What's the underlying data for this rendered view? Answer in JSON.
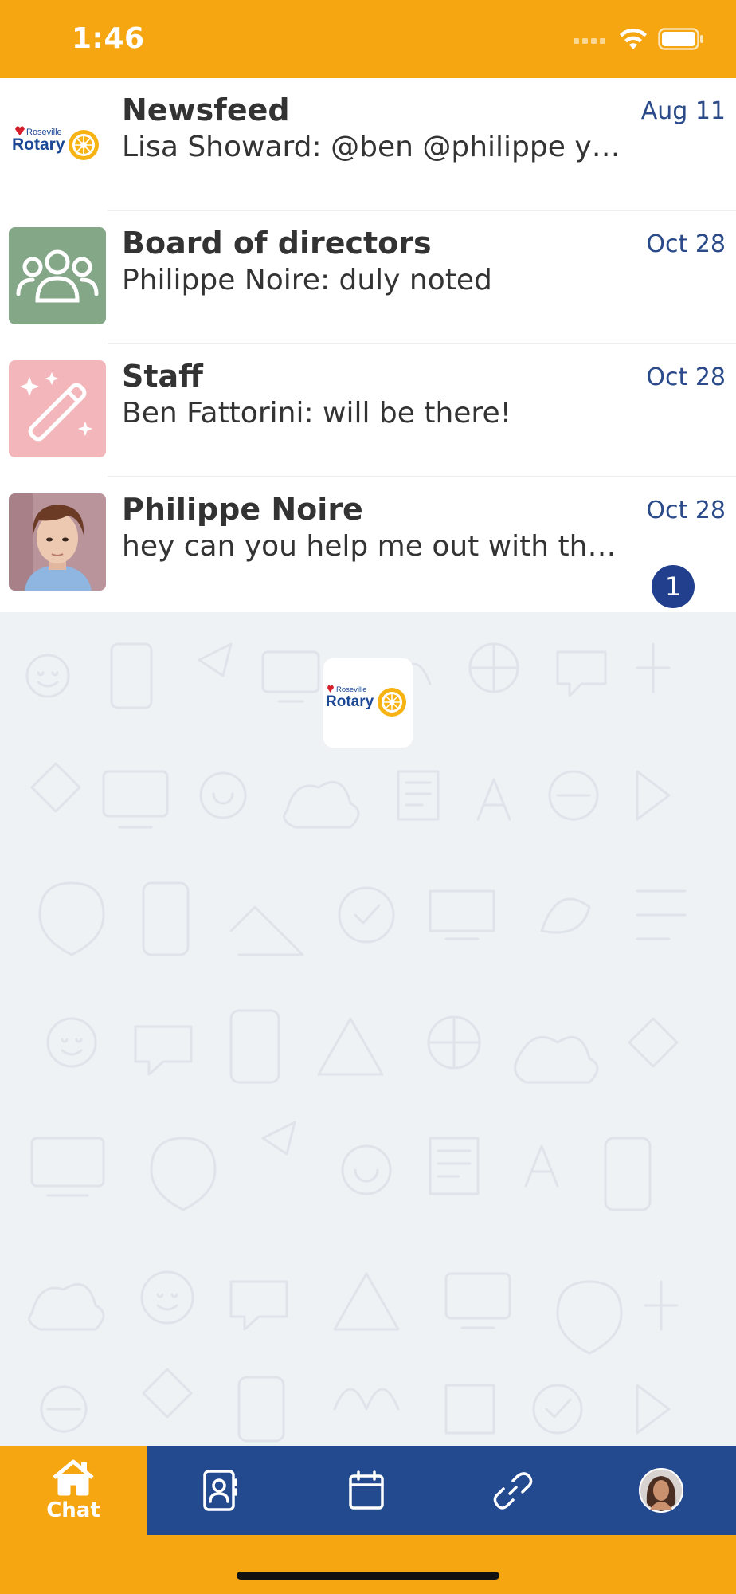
{
  "status_bar": {
    "time": "1:46"
  },
  "chats": [
    {
      "title": "Newsfeed",
      "preview": "Lisa Showard: @ben @philippe you...",
      "date": "Aug 11",
      "avatar": "rotary-logo"
    },
    {
      "title": "Board of directors",
      "preview": "Philippe Noire: duly noted",
      "date": "Oct 28",
      "avatar": "group-icon"
    },
    {
      "title": "Staff",
      "preview": "Ben Fattorini: will be there!",
      "date": "Oct 28",
      "avatar": "magic-wand-icon"
    },
    {
      "title": "Philippe Noire",
      "preview": "hey can you help me out with the ...",
      "date": "Oct 28",
      "avatar": "person-photo",
      "unread": "1"
    }
  ],
  "logo": {
    "top_text": "Roseville",
    "main_text": "Rotary"
  },
  "tabs": [
    {
      "label": "Chat",
      "icon": "home-icon",
      "active": true
    },
    {
      "label": "",
      "icon": "contacts-icon"
    },
    {
      "label": "",
      "icon": "calendar-icon"
    },
    {
      "label": "",
      "icon": "link-icon"
    },
    {
      "label": "",
      "icon": "profile-avatar"
    }
  ],
  "colors": {
    "accent": "#f5a611",
    "navy": "#234a8f",
    "group_bg": "#84a788",
    "staff_bg": "#f3b7bb"
  }
}
